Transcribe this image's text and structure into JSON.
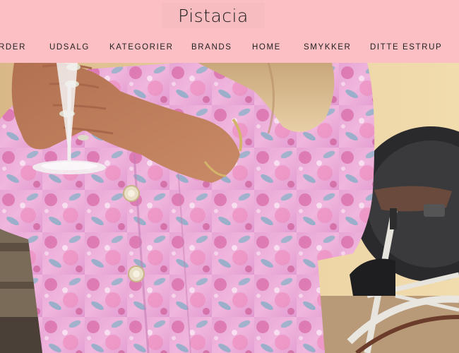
{
  "header": {
    "logo_text": "Pistacia",
    "background_color": "#fcc0c4"
  },
  "nav": {
    "items": [
      {
        "label": "RDER"
      },
      {
        "label": "UDSALG"
      },
      {
        "label": "KATEGORIER"
      },
      {
        "label": "BRANDS"
      },
      {
        "label": "HOME"
      },
      {
        "label": "SMYKKER"
      },
      {
        "label": "DITTE ESTRUP"
      }
    ]
  },
  "hero": {
    "image_subject": "person in pink floral blazer holding a wine glass next to a bicycle"
  }
}
